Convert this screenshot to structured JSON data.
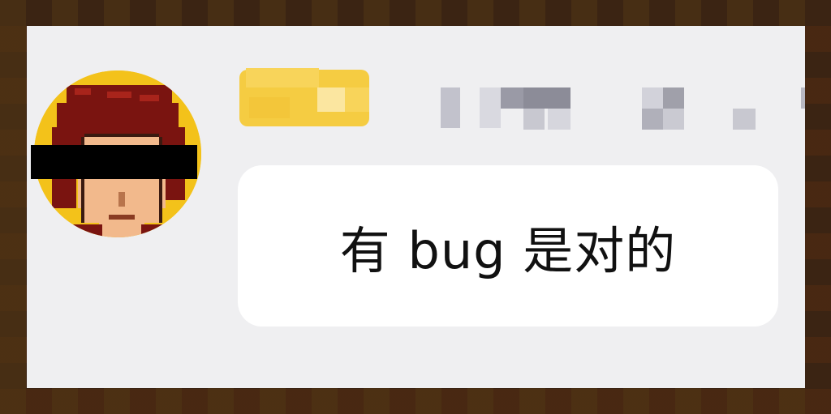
{
  "message": {
    "text": "有 bug 是对的",
    "sender_avatar_icon": "pixel-art-avatar-icon"
  },
  "colors": {
    "panel_background": "#efeff1",
    "bubble_background": "#ffffff",
    "avatar_background": "#f3c21a",
    "censor_bar": "#000000",
    "name_highlight": "#f6c623"
  }
}
